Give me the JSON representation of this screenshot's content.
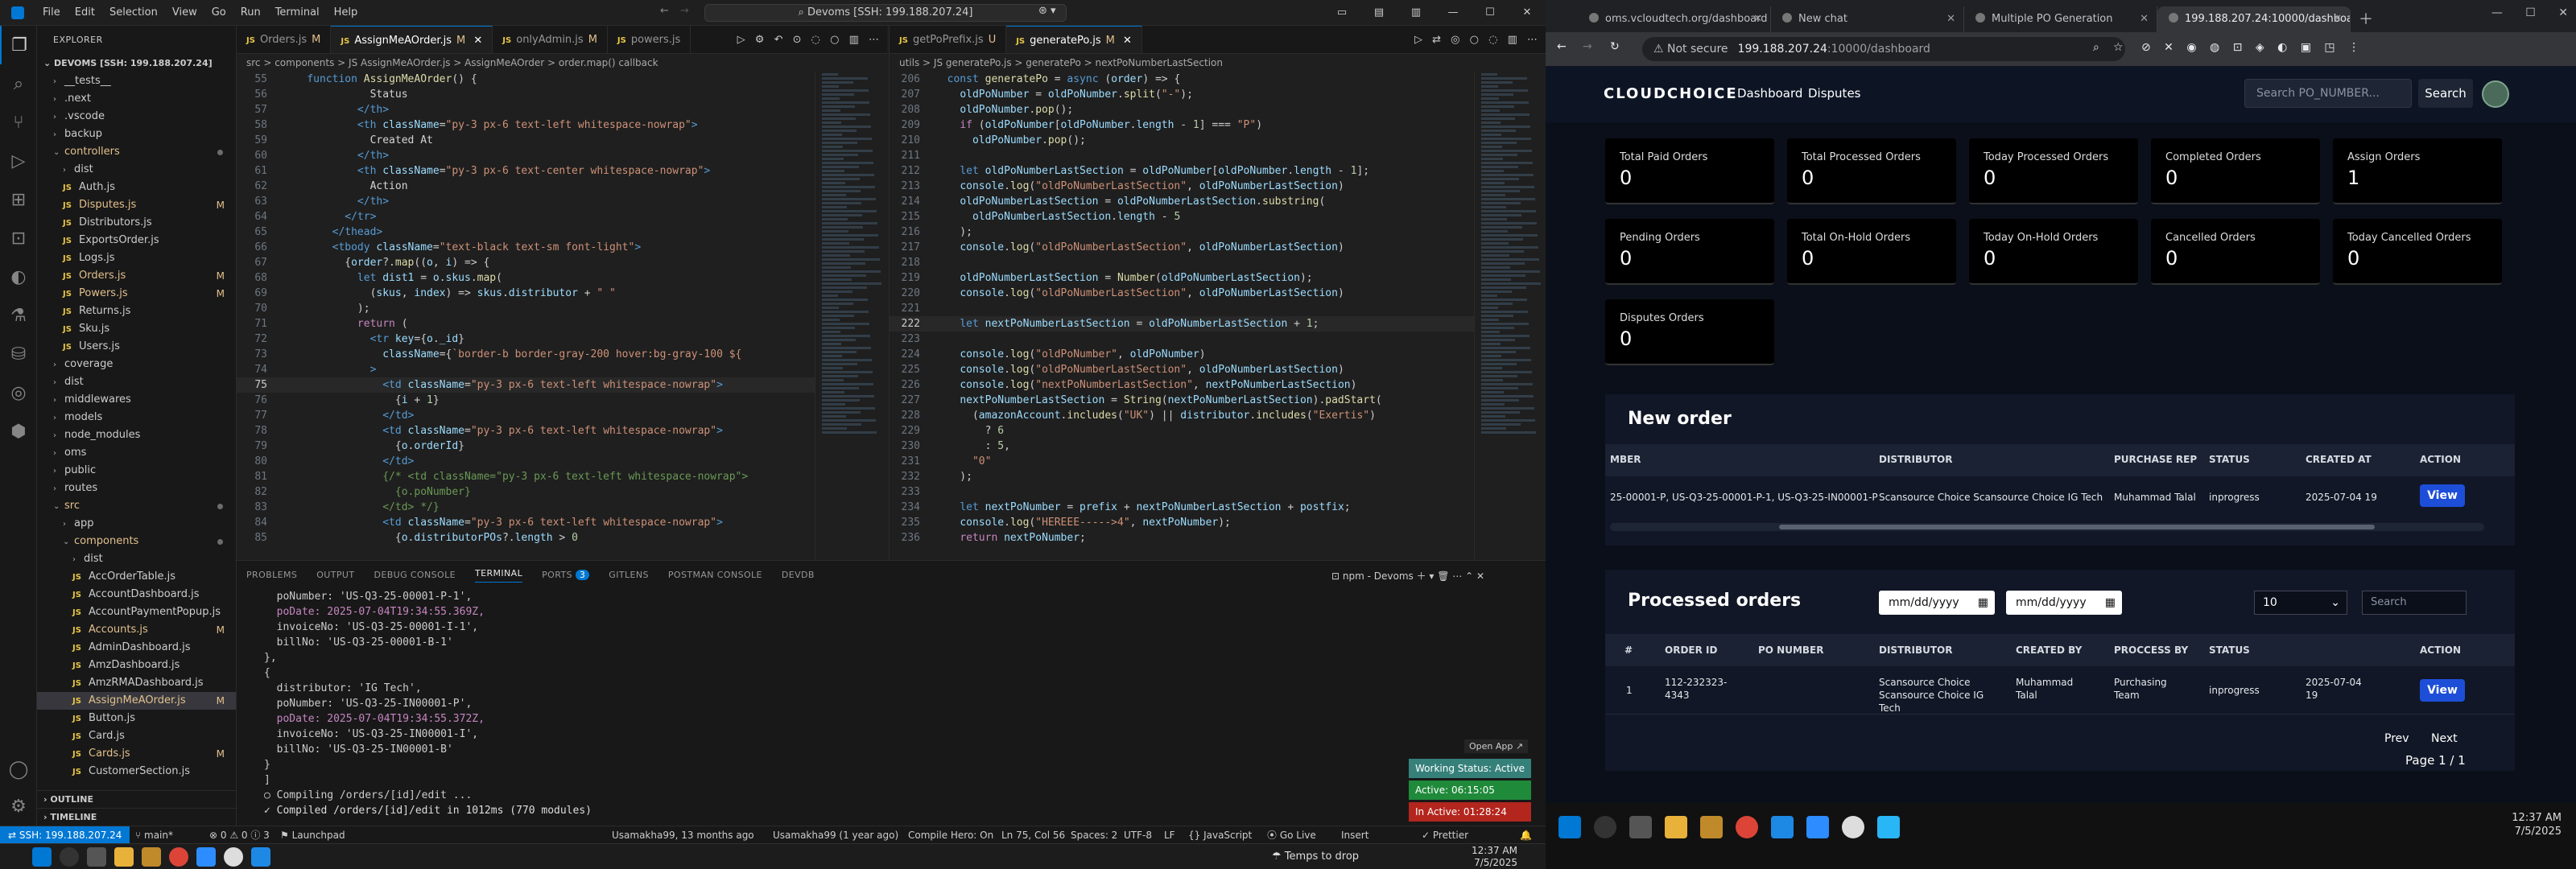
{
  "vscode": {
    "menu": [
      "File",
      "Edit",
      "Selection",
      "View",
      "Go",
      "Run",
      "Terminal",
      "Help"
    ],
    "search": "Devoms [SSH: 199.188.207.24]",
    "explorer": {
      "header": "EXPLORER",
      "root": "DEVOMS [SSH: 199.188.207.24]",
      "items": [
        {
          "d": 1,
          "k": "f",
          "n": "__tests__"
        },
        {
          "d": 1,
          "k": "f",
          "n": ".next"
        },
        {
          "d": 1,
          "k": "f",
          "n": ".vscode"
        },
        {
          "d": 1,
          "k": "f",
          "n": "backup"
        },
        {
          "d": 1,
          "k": "o",
          "n": "controllers",
          "col": "#e2c08d",
          "dot": true
        },
        {
          "d": 2,
          "k": "f",
          "n": "dist"
        },
        {
          "d": 2,
          "k": "j",
          "n": "Auth.js"
        },
        {
          "d": 2,
          "k": "j",
          "n": "Disputes.js",
          "col": "#e2c08d",
          "badge": "M"
        },
        {
          "d": 2,
          "k": "j",
          "n": "Distributors.js"
        },
        {
          "d": 2,
          "k": "j",
          "n": "ExportsOrder.js"
        },
        {
          "d": 2,
          "k": "j",
          "n": "Logs.js"
        },
        {
          "d": 2,
          "k": "j",
          "n": "Orders.js",
          "col": "#e2c08d",
          "badge": "M"
        },
        {
          "d": 2,
          "k": "j",
          "n": "Powers.js",
          "col": "#e2c08d",
          "badge": "M"
        },
        {
          "d": 2,
          "k": "j",
          "n": "Returns.js"
        },
        {
          "d": 2,
          "k": "j",
          "n": "Sku.js"
        },
        {
          "d": 2,
          "k": "j",
          "n": "Users.js"
        },
        {
          "d": 1,
          "k": "f",
          "n": "coverage"
        },
        {
          "d": 1,
          "k": "f",
          "n": "dist"
        },
        {
          "d": 1,
          "k": "f",
          "n": "middlewares"
        },
        {
          "d": 1,
          "k": "f",
          "n": "models"
        },
        {
          "d": 1,
          "k": "f",
          "n": "node_modules"
        },
        {
          "d": 1,
          "k": "f",
          "n": "oms"
        },
        {
          "d": 1,
          "k": "f",
          "n": "public"
        },
        {
          "d": 1,
          "k": "f",
          "n": "routes"
        },
        {
          "d": 1,
          "k": "o",
          "n": "src",
          "col": "#e2c08d",
          "dot": true
        },
        {
          "d": 2,
          "k": "f",
          "n": "app"
        },
        {
          "d": 2,
          "k": "o",
          "n": "components",
          "col": "#e2c08d",
          "dot": true
        },
        {
          "d": 3,
          "k": "f",
          "n": "dist"
        },
        {
          "d": 3,
          "k": "j",
          "n": "AccOrderTable.js"
        },
        {
          "d": 3,
          "k": "j",
          "n": "AccountDashboard.js"
        },
        {
          "d": 3,
          "k": "j",
          "n": "AccountPaymentPopup.js"
        },
        {
          "d": 3,
          "k": "j",
          "n": "Accounts.js",
          "col": "#e2c08d",
          "badge": "M"
        },
        {
          "d": 3,
          "k": "j",
          "n": "AdminDashboard.js"
        },
        {
          "d": 3,
          "k": "j",
          "n": "AmzDashboard.js"
        },
        {
          "d": 3,
          "k": "j",
          "n": "AmzRMADashboard.js"
        },
        {
          "d": 3,
          "k": "j",
          "n": "AssignMeAOrder.js",
          "col": "#e2c08d",
          "badge": "M",
          "sel": true
        },
        {
          "d": 3,
          "k": "j",
          "n": "Button.js"
        },
        {
          "d": 3,
          "k": "j",
          "n": "Card.js"
        },
        {
          "d": 3,
          "k": "j",
          "n": "Cards.js",
          "col": "#e2c08d",
          "badge": "M"
        },
        {
          "d": 3,
          "k": "j",
          "n": "CustomerSection.js"
        }
      ],
      "outline": "OUTLINE",
      "timeline": "TIMELINE"
    },
    "editor1": {
      "tabs": [
        {
          "n": "Orders.js",
          "m": "M"
        },
        {
          "n": "AssignMeAOrder.js",
          "m": "M",
          "active": true
        },
        {
          "n": "onlyAdmin.js",
          "m": "M"
        },
        {
          "n": "powers.js",
          "m": ""
        }
      ],
      "crumb": "src > components > JS AssignMeAOrder.js > AssignMeAOrder > order.map() callback",
      "lines": [
        {
          "n": "55",
          "h": "    <span class=\"kw\">function</span> <span class=\"fn\">AssignMeAOrder</span>() {"
        },
        {
          "n": "56",
          "h": "              <span class=\"txt\">Status</span>"
        },
        {
          "n": "57",
          "h": "            <span class=\"tag\">&lt;/th&gt;</span>"
        },
        {
          "n": "58",
          "h": "            <span class=\"tag\">&lt;th</span> <span class=\"attr\">className</span>=<span class=\"str\">\"py-3 px-6 text-left whitespace-nowrap\"</span><span class=\"tag\">&gt;</span>"
        },
        {
          "n": "59",
          "h": "              <span class=\"txt\">Created At</span>"
        },
        {
          "n": "60",
          "h": "            <span class=\"tag\">&lt;/th&gt;</span>"
        },
        {
          "n": "61",
          "h": "            <span class=\"tag\">&lt;th</span> <span class=\"attr\">className</span>=<span class=\"str\">\"py-3 px-6 text-center whitespace-nowrap\"</span><span class=\"tag\">&gt;</span>"
        },
        {
          "n": "62",
          "h": "              <span class=\"txt\">Action</span>"
        },
        {
          "n": "63",
          "h": "            <span class=\"tag\">&lt;/th&gt;</span>"
        },
        {
          "n": "64",
          "h": "          <span class=\"tag\">&lt;/tr&gt;</span>"
        },
        {
          "n": "65",
          "h": "        <span class=\"tag\">&lt;/thead&gt;</span>"
        },
        {
          "n": "66",
          "h": "        <span class=\"tag\">&lt;tbody</span> <span class=\"attr\">className</span>=<span class=\"str\">\"text-black text-sm font-light\"</span><span class=\"tag\">&gt;</span>"
        },
        {
          "n": "67",
          "h": "          {<span class=\"var\">order</span>?.<span class=\"fn\">map</span>((<span class=\"var\">o</span>, <span class=\"var\">i</span>) =&gt; {"
        },
        {
          "n": "68",
          "h": "            <span class=\"kw\">let</span> <span class=\"var\">dist1</span> = <span class=\"var\">o</span>.<span class=\"var\">skus</span>.<span class=\"fn\">map</span>("
        },
        {
          "n": "69",
          "h": "              (<span class=\"var\">skus</span>, <span class=\"var\">index</span>) =&gt; <span class=\"var\">skus</span>.<span class=\"var\">distributor</span> + <span class=\"str\">\" \"</span>"
        },
        {
          "n": "70",
          "h": "            );"
        },
        {
          "n": "71",
          "h": "            <span class=\"kw2\">return</span> ("
        },
        {
          "n": "72",
          "h": "              <span class=\"tag\">&lt;tr</span> <span class=\"attr\">key</span>={<span class=\"var\">o</span>.<span class=\"var\">_id</span>}"
        },
        {
          "n": "73",
          "h": "                <span class=\"attr\">className</span>={<span class=\"str\">`border-b border-gray-200 hover:bg-gray-100 ${</span>"
        },
        {
          "n": "74",
          "h": "              <span class=\"tag\">&gt;</span>"
        },
        {
          "n": "75",
          "h": "                <span class=\"tag\">&lt;td</span> <span class=\"attr\">className</span>=<span class=\"str\">\"py-3 px-6 text-left whitespace-nowrap\"</span><span class=\"tag\">&gt;</span>",
          "cur": true
        },
        {
          "n": "76",
          "h": "                  {<span class=\"var\">i</span> + <span class=\"num\">1</span>}"
        },
        {
          "n": "77",
          "h": "                <span class=\"tag\">&lt;/td&gt;</span>"
        },
        {
          "n": "78",
          "h": "                <span class=\"tag\">&lt;td</span> <span class=\"attr\">className</span>=<span class=\"str\">\"py-3 px-6 text-left whitespace-nowrap\"</span><span class=\"tag\">&gt;</span>"
        },
        {
          "n": "79",
          "h": "                  {<span class=\"var\">o</span>.<span class=\"var\">orderId</span>}"
        },
        {
          "n": "80",
          "h": "                <span class=\"tag\">&lt;/td&gt;</span>"
        },
        {
          "n": "81",
          "h": "                <span class=\"com\">{/* &lt;td className=\"py-3 px-6 text-left whitespace-nowrap\"&gt;</span>"
        },
        {
          "n": "82",
          "h": "                  <span class=\"com\">{o.poNumber}</span>"
        },
        {
          "n": "83",
          "h": "                <span class=\"com\">&lt;/td&gt; */}</span>"
        },
        {
          "n": "84",
          "h": "                <span class=\"tag\">&lt;td</span> <span class=\"attr\">className</span>=<span class=\"str\">\"py-3 px-6 text-left whitespace-nowrap\"</span><span class=\"tag\">&gt;</span>"
        },
        {
          "n": "85",
          "h": "                  {<span class=\"var\">o</span>.<span class=\"var\">distributorPOs</span>?.<span class=\"var\">length</span> &gt; <span class=\"num\">0</span>"
        }
      ]
    },
    "editor2": {
      "tabs": [
        {
          "n": "getPoPrefix.js",
          "m": "U"
        },
        {
          "n": "generatePo.js",
          "m": "M",
          "active": true
        }
      ],
      "crumb": "utils > JS generatePo.js > generatePo > nextPoNumberLastSection",
      "lines": [
        {
          "n": "206",
          "h": "  <span class=\"kw\">const</span> <span class=\"fn\">generatePo</span> = <span class=\"kw\">async</span> (<span class=\"var\">order</span>) =&gt; {"
        },
        {
          "n": "207",
          "h": "    <span class=\"var\">oldPoNumber</span> = <span class=\"var\">oldPoNumber</span>.<span class=\"fn\">split</span>(<span class=\"str\">\"-\"</span>);"
        },
        {
          "n": "208",
          "h": "    <span class=\"var\">oldPoNumber</span>.<span class=\"fn\">pop</span>();"
        },
        {
          "n": "209",
          "h": "    <span class=\"kw2\">if</span> (<span class=\"var\">oldPoNumber</span>[<span class=\"var\">oldPoNumber</span>.<span class=\"var\">length</span> - <span class=\"num\">1</span>] === <span class=\"str\">\"P\"</span>)"
        },
        {
          "n": "210",
          "h": "      <span class=\"var\">oldPoNumber</span>.<span class=\"fn\">pop</span>();"
        },
        {
          "n": "211",
          "h": ""
        },
        {
          "n": "212",
          "h": "    <span class=\"kw\">let</span> <span class=\"var\">oldPoNumberLastSection</span> = <span class=\"var\">oldPoNumber</span>[<span class=\"var\">oldPoNumber</span>.<span class=\"var\">length</span> - <span class=\"num\">1</span>];"
        },
        {
          "n": "213",
          "h": "    <span class=\"var\">console</span>.<span class=\"fn\">log</span>(<span class=\"str\">\"oldPoNumberLastSection\"</span>, <span class=\"var\">oldPoNumberLastSection</span>)"
        },
        {
          "n": "214",
          "h": "    <span class=\"var\">oldPoNumberLastSection</span> = <span class=\"var\">oldPoNumberLastSection</span>.<span class=\"fn\">substring</span>("
        },
        {
          "n": "215",
          "h": "      <span class=\"var\">oldPoNumberLastSection</span>.<span class=\"var\">length</span> - <span class=\"num\">5</span>"
        },
        {
          "n": "216",
          "h": "    );"
        },
        {
          "n": "217",
          "h": "    <span class=\"var\">console</span>.<span class=\"fn\">log</span>(<span class=\"str\">\"oldPoNumberLastSection\"</span>, <span class=\"var\">oldPoNumberLastSection</span>)"
        },
        {
          "n": "218",
          "h": ""
        },
        {
          "n": "219",
          "h": "    <span class=\"var\">oldPoNumberLastSection</span> = <span class=\"fn\">Number</span>(<span class=\"var\">oldPoNumberLastSection</span>);"
        },
        {
          "n": "220",
          "h": "    <span class=\"var\">console</span>.<span class=\"fn\">log</span>(<span class=\"str\">\"oldPoNumberLastSection\"</span>, <span class=\"var\">oldPoNumberLastSection</span>)"
        },
        {
          "n": "221",
          "h": ""
        },
        {
          "n": "222",
          "h": "    <span class=\"kw\">let</span> <span class=\"var\">nextPoNumberLastSection</span> = <span class=\"var\">oldPoNumberLastSection</span> + <span class=\"num\">1</span>;",
          "cur": true
        },
        {
          "n": "223",
          "h": ""
        },
        {
          "n": "224",
          "h": "    <span class=\"var\">console</span>.<span class=\"fn\">log</span>(<span class=\"str\">\"oldPoNumber\"</span>, <span class=\"var\">oldPoNumber</span>)"
        },
        {
          "n": "225",
          "h": "    <span class=\"var\">console</span>.<span class=\"fn\">log</span>(<span class=\"str\">\"oldPoNumberLastSection\"</span>, <span class=\"var\">oldPoNumberLastSection</span>)"
        },
        {
          "n": "226",
          "h": "    <span class=\"var\">console</span>.<span class=\"fn\">log</span>(<span class=\"str\">\"nextPoNumberLastSection\"</span>, <span class=\"var\">nextPoNumberLastSection</span>)"
        },
        {
          "n": "227",
          "h": "    <span class=\"var\">nextPoNumberLastSection</span> = <span class=\"fn\">String</span>(<span class=\"var\">nextPoNumberLastSection</span>).<span class=\"fn\">padStart</span>("
        },
        {
          "n": "228",
          "h": "      (<span class=\"var\">amazonAccount</span>.<span class=\"fn\">includes</span>(<span class=\"str\">\"UK\"</span>) || <span class=\"var\">distributor</span>.<span class=\"fn\">includes</span>(<span class=\"str\">\"Exertis\"</span>)"
        },
        {
          "n": "229",
          "h": "        ? <span class=\"num\">6</span>"
        },
        {
          "n": "230",
          "h": "        : <span class=\"num\">5</span>,"
        },
        {
          "n": "231",
          "h": "      <span class=\"str\">\"0\"</span>"
        },
        {
          "n": "232",
          "h": "    );"
        },
        {
          "n": "233",
          "h": ""
        },
        {
          "n": "234",
          "h": "    <span class=\"kw\">let</span> <span class=\"var\">nextPoNumber</span> = <span class=\"var\">prefix</span> + <span class=\"var\">nextPoNumberLastSection</span> + <span class=\"var\">postfix</span>;"
        },
        {
          "n": "235",
          "h": "    <span class=\"var\">console</span>.<span class=\"fn\">log</span>(<span class=\"str\">\"HEREEE-----&gt;4\"</span>, <span class=\"var\">nextPoNumber</span>);"
        },
        {
          "n": "236",
          "h": "    <span class=\"kw2\">return</span> <span class=\"var\">nextPoNumber</span>;"
        }
      ]
    },
    "panel": {
      "tabs": [
        "PROBLEMS",
        "OUTPUT",
        "DEBUG CONSOLE",
        "TERMINAL",
        "PORTS",
        "GITLENS",
        "POSTMAN CONSOLE",
        "DEVDB"
      ],
      "ports_badge": "3",
      "shell": "npm - Devoms",
      "terminal": [
        "  poNumber: 'US-Q3-25-00001-P-1',",
        "  poDate: 2025-07-04T19:34:55.369Z,",
        "  invoiceNo: 'US-Q3-25-00001-I-1',",
        "  billNo: 'US-Q3-25-00001-B-1'",
        "},",
        "{",
        "  distributor: 'IG Tech',",
        "  poNumber: 'US-Q3-25-IN00001-P',",
        "  poDate: 2025-07-04T19:34:55.372Z,",
        "  invoiceNo: 'US-Q3-25-IN00001-I',",
        "  billNo: 'US-Q3-25-IN00001-B'",
        "}",
        "]",
        "○ Compiling /orders/[id]/edit ...",
        "✓ Compiled /orders/[id]/edit in 1012ms (770 modules)"
      ],
      "open_app": "Open App ↗",
      "working": "Working Status: Active",
      "active": "Active: 06:15:05",
      "inactive": "In Active: 01:28:24"
    },
    "status": {
      "remote": "SSH: 199.188.207.24",
      "branch": "main*",
      "errors": "⊗ 0  ⚠ 0  ⓘ 3",
      "launchpad": "Launchpad",
      "blame1": "Usamakha99, 13 months ago",
      "blame2": "Usamakha99 (1 year ago)",
      "compile": "Compile Hero: On",
      "pos": "Ln 75, Col 56",
      "spaces": "Spaces: 2",
      "enc": "UTF-8",
      "eol": "LF",
      "lang": "{} JavaScript",
      "golive": "Go Live",
      "insert": "Insert",
      "prettier": "Prettier"
    },
    "taskbar": {
      "weather": "Temps to drop",
      "time": "12:37 AM",
      "date": "7/5/2025"
    }
  },
  "chrome": {
    "tabs": [
      {
        "n": "oms.vcloudtech.org/dashboard"
      },
      {
        "n": "New chat"
      },
      {
        "n": "Multiple PO Generation"
      },
      {
        "n": "199.188.207.24:10000/dashboard",
        "on": true
      }
    ],
    "not_secure": "Not secure",
    "url_host": "199.188.207.24",
    "url_path": ":10000/dashboard"
  },
  "app": {
    "logo": "CLOUDCHOICE",
    "nav": [
      "Dashboard",
      "Disputes"
    ],
    "search_placeholder": "Search PO_NUMBER...",
    "search_btn": "Search",
    "cards": [
      {
        "l": "Total Paid Orders",
        "v": "0"
      },
      {
        "l": "Total Processed Orders",
        "v": "0"
      },
      {
        "l": "Today Processed Orders",
        "v": "0"
      },
      {
        "l": "Completed Orders",
        "v": "0"
      },
      {
        "l": "Assign Orders",
        "v": "1"
      },
      {
        "l": "Pending Orders",
        "v": "0"
      },
      {
        "l": "Total On-Hold Orders",
        "v": "0"
      },
      {
        "l": "Today On-Hold Orders",
        "v": "0"
      },
      {
        "l": "Cancelled Orders",
        "v": "0"
      },
      {
        "l": "Today Cancelled Orders",
        "v": "0"
      },
      {
        "l": "Disputes Orders",
        "v": "0"
      }
    ],
    "new_order": {
      "title": "New order",
      "headers": [
        "MBER",
        "DISTRIBUTOR",
        "PURCHASE REP",
        "STATUS",
        "CREATED AT",
        "ACTION"
      ],
      "row": {
        "number": "25-00001-P, US-Q3-25-00001-P-1, US-Q3-25-IN00001-P",
        "distributor": "Scansource Choice Scansource Choice IG Tech",
        "rep": "Muhammad Talal",
        "status": "inprogress",
        "created": "2025-07-04 19",
        "action": "View"
      }
    },
    "processed": {
      "title": "Processed orders",
      "date1": "mm/dd/yyyy",
      "date2": "mm/dd/yyyy",
      "page_size": "10",
      "search_placeholder": "Search",
      "headers": [
        "#",
        "ORDER ID",
        "PO NUMBER",
        "DISTRIBUTOR",
        "CREATED BY",
        "PROCCESS BY",
        "STATUS",
        "ACTION"
      ],
      "row": {
        "idx": "1",
        "order_id": "112-232323-4343",
        "po": "",
        "distributor": "Scansource Choice Scansource Choice IG Tech",
        "created_by": "Muhammad Talal",
        "process_by": "Purchasing Team",
        "status": "inprogress",
        "created_at": "2025-07-04 19",
        "action": "View"
      },
      "prev": "Prev",
      "next": "Next",
      "page": "Page 1 / 1"
    }
  },
  "wintask": {
    "time": "12:37 AM",
    "date": "7/5/2025"
  }
}
